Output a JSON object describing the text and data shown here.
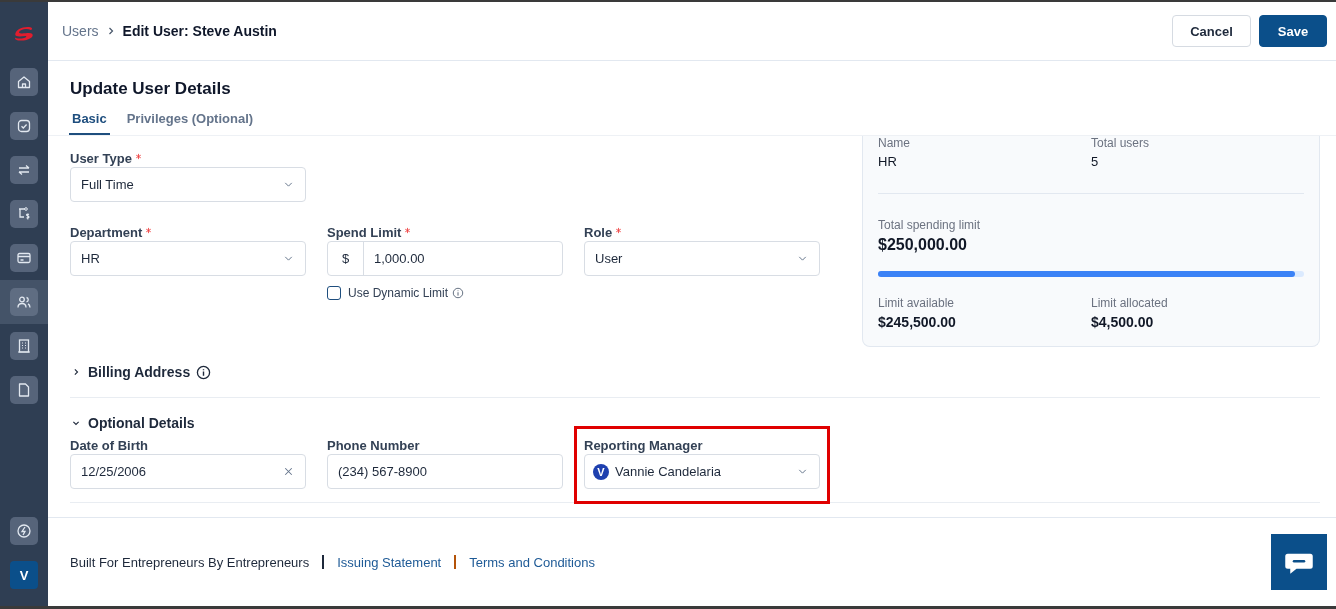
{
  "sidebar": {
    "items": [
      {
        "kind": "home",
        "selected": false
      },
      {
        "kind": "check",
        "selected": false
      },
      {
        "kind": "transfer",
        "selected": false
      },
      {
        "kind": "flow",
        "selected": false
      },
      {
        "kind": "card",
        "selected": false
      },
      {
        "kind": "users",
        "selected": true
      },
      {
        "kind": "building",
        "selected": false
      },
      {
        "kind": "document",
        "selected": false
      }
    ],
    "bottom": [
      {
        "kind": "bolt"
      },
      {
        "kind": "avatar",
        "initial": "V"
      }
    ]
  },
  "header": {
    "breadcrumb": {
      "parent": "Users",
      "current": "Edit User: Steve Austin"
    },
    "buttons": [
      {
        "label": "Cancel",
        "kind": "secondary"
      },
      {
        "label": "Save",
        "kind": "primary"
      }
    ]
  },
  "page_title": "Update User Details",
  "tabs": [
    {
      "label": "Basic",
      "selected": true
    },
    {
      "label": "Privileges (Optional)",
      "selected": false
    }
  ],
  "form_rows": [
    [
      {
        "kind": "select",
        "label": "User Type",
        "required": true,
        "value": "Full Time"
      }
    ],
    [
      {
        "kind": "select",
        "label": "Department",
        "required": true,
        "value": "HR"
      },
      {
        "kind": "money",
        "label": "Spend Limit",
        "required": true,
        "prefix": "$",
        "value": "1,000.00",
        "checkbox": {
          "label": "Use Dynamic Limit",
          "checked": false
        }
      },
      {
        "kind": "select",
        "label": "Role",
        "required": true,
        "value": "User"
      }
    ]
  ],
  "department_card": {
    "name_label": "Name",
    "name": "HR",
    "users_label": "Total users",
    "users": "5",
    "total_label": "Total spending limit",
    "total": "$250,000.00",
    "level": 0.98,
    "available_label": "Limit available",
    "available": "$245,500.00",
    "allocated_label": "Limit allocated",
    "allocated": "$4,500.00"
  },
  "sections": [
    {
      "title": "Billing Address",
      "expanded": false,
      "info": true
    },
    {
      "title": "Optional Details",
      "expanded": true,
      "info": false,
      "fields": [
        {
          "kind": "date",
          "label": "Date of Birth",
          "required": false,
          "value": "12/25/2006"
        },
        {
          "kind": "text",
          "label": "Phone Number",
          "required": false,
          "value": "(234) 567-8900"
        },
        {
          "kind": "person",
          "label": "Reporting Manager",
          "required": false,
          "initial": "V",
          "value": "Vannie Candelaria",
          "highlighted": true
        }
      ]
    }
  ],
  "footer": [
    {
      "kind": "text",
      "text": "Built For Entrepreneurs By Entrepreneurs"
    },
    {
      "kind": "separator",
      "color": "#1e293b"
    },
    {
      "kind": "link",
      "text": "Issuing Statement"
    },
    {
      "kind": "separator",
      "color": "#b45309"
    },
    {
      "kind": "link",
      "text": "Terms and Conditions"
    }
  ]
}
